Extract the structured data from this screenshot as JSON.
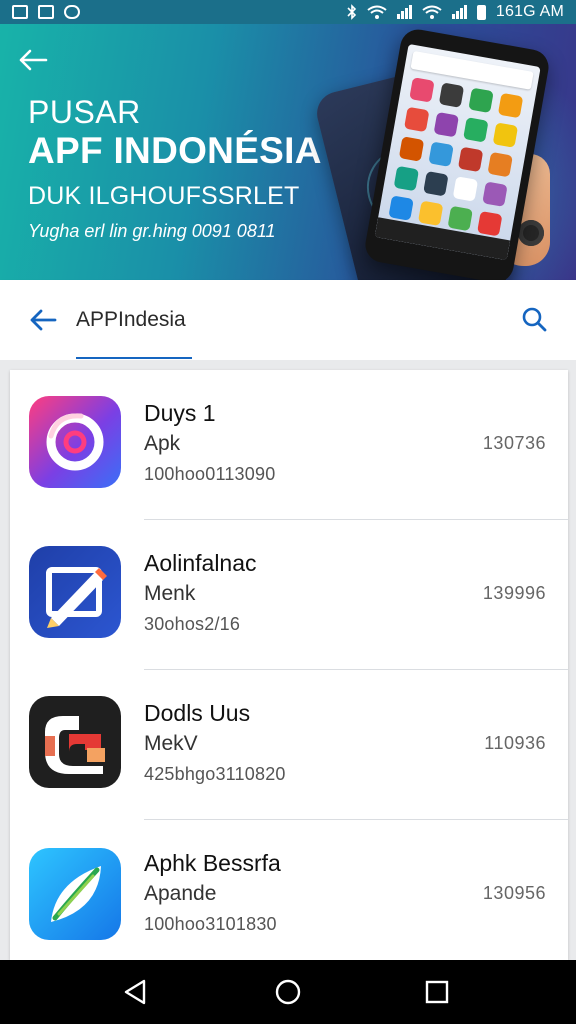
{
  "status_bar": {
    "time": "161G AM",
    "icons": [
      "image-icon",
      "video-icon",
      "messenger-icon",
      "bluetooth-icon",
      "wifi-icon",
      "signal-icon",
      "wifi-icon",
      "signal-icon",
      "battery-icon"
    ]
  },
  "hero": {
    "back_icon": "arrow-left-icon",
    "title_line1": "PUSAR",
    "title_line2": "APF INDONÉSIA",
    "subtitle": "DUK ILGHOUFSSRLET",
    "note": "Yugha erl lin gr.hing 0091 0811",
    "colors": {
      "gradient_start": "#18b3a9",
      "gradient_end": "#3a3488"
    }
  },
  "search": {
    "query": "APPIndesia",
    "back_icon": "arrow-left-icon",
    "search_icon": "search-icon",
    "accent_color": "#1565c0"
  },
  "apps": [
    {
      "name": "Duys 1",
      "type": "Apk",
      "code": "100hoo0113090",
      "number": "130736",
      "icon": "ring-logo-icon"
    },
    {
      "name": "Aolinfalnac",
      "type": "Menk",
      "code": "30ohos2/16",
      "number": "139996",
      "icon": "pencil-edit-icon"
    },
    {
      "name": "Dodls Uus",
      "type": "MekV",
      "code": "425bhgo3110820",
      "number": "110936",
      "icon": "abstract-shape-icon"
    },
    {
      "name": "Aphk Bessrfa",
      "type": "Apande",
      "code": "100hoo3101830",
      "number": "130956",
      "icon": "leaf-icon"
    }
  ],
  "navigation": {
    "back_icon": "triangle-back-icon",
    "home_icon": "circle-home-icon",
    "recents_icon": "square-recents-icon"
  }
}
